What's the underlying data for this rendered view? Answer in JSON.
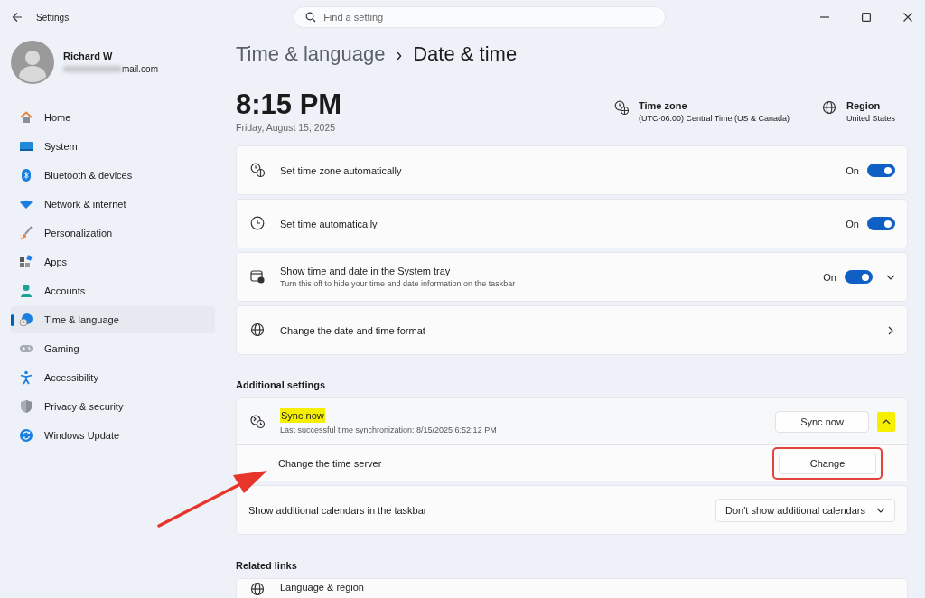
{
  "window": {
    "title": "Settings"
  },
  "search": {
    "placeholder": "Find a setting"
  },
  "user": {
    "name": "Richard W",
    "email": "mail.com"
  },
  "sidebar": {
    "items": [
      {
        "label": "Home",
        "selected": false
      },
      {
        "label": "System",
        "selected": false
      },
      {
        "label": "Bluetooth & devices",
        "selected": false
      },
      {
        "label": "Network & internet",
        "selected": false
      },
      {
        "label": "Personalization",
        "selected": false
      },
      {
        "label": "Apps",
        "selected": false
      },
      {
        "label": "Accounts",
        "selected": false
      },
      {
        "label": "Time & language",
        "selected": true
      },
      {
        "label": "Gaming",
        "selected": false
      },
      {
        "label": "Accessibility",
        "selected": false
      },
      {
        "label": "Privacy & security",
        "selected": false
      },
      {
        "label": "Windows Update",
        "selected": false
      }
    ]
  },
  "breadcrumb": {
    "parent": "Time & language",
    "separator": "›",
    "current": "Date & time"
  },
  "clock": {
    "time": "8:15 PM",
    "date": "Friday, August 15, 2025"
  },
  "info": [
    {
      "label": "Time zone",
      "value": "(UTC-06:00) Central Time (US & Canada)"
    },
    {
      "label": "Region",
      "value": "United States"
    }
  ],
  "settings": [
    {
      "kind": "toggle",
      "label": "Set time zone automatically",
      "state": "On",
      "on": true
    },
    {
      "kind": "toggle",
      "label": "Set time automatically",
      "state": "On",
      "on": true
    },
    {
      "kind": "toggle",
      "label": "Show time and date in the System tray",
      "description": "Turn this off to hide your time and date information on the taskbar",
      "state": "On",
      "on": true,
      "expandable": true
    },
    {
      "kind": "link",
      "label": "Change the date and time format"
    }
  ],
  "additional": {
    "heading": "Additional settings",
    "items": [
      {
        "kind": "expander",
        "label": "Sync now",
        "highlighted": true,
        "description": "Last successful time synchronization: 8/15/2025 6:52:12 PM",
        "button": "Sync now",
        "expanded": true,
        "children": [
          {
            "kind": "button",
            "label": "Change the time server",
            "button": "Change",
            "outlined": true
          }
        ]
      },
      {
        "kind": "dropdown",
        "label": "Show additional calendars in the taskbar",
        "value": "Don't show additional calendars"
      }
    ]
  },
  "related": {
    "heading": "Related links",
    "items": [
      {
        "label": "Language & region"
      }
    ]
  },
  "annotations": [
    {
      "kind": "arrow"
    }
  ]
}
